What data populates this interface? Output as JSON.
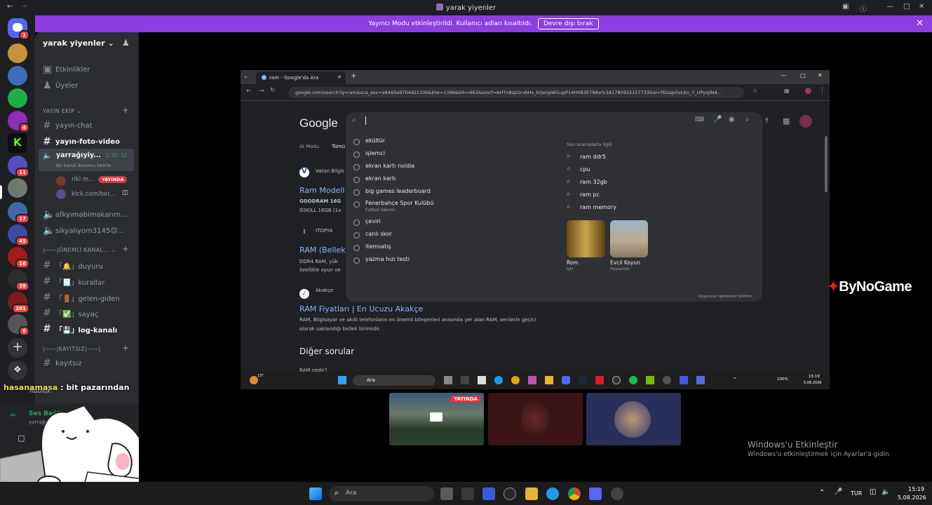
{
  "titlebar": {
    "title": "yarak yiyenler"
  },
  "banner": {
    "text": "Yayıncı Modu etkinleştirildi. Kullanıcı adları kısaltıldı.",
    "button": "Devre dışı bırak"
  },
  "guild_badges": [
    "1",
    "4",
    "11",
    "17",
    "45",
    "16",
    "39",
    "201",
    "6"
  ],
  "server": {
    "name": "yarak yiyenler"
  },
  "sidebar": {
    "top": [
      "Etkinlikler",
      "Üyeler"
    ],
    "cat1": "YAYIN EKİP",
    "ch1": "yayın-chat",
    "ch2": "yayın-foto-video",
    "voice1": "yarrağıyiy...",
    "voice1_time": "1:45:52",
    "voice1_status": "Bir kanal durumu belirle",
    "vm1": "riki m...",
    "vm1_badge": "YAYINDA",
    "vm2": "kick.com/ber...",
    "v2": "afkyımabimakarım...",
    "v3": "sikyalıyom3145😊...",
    "cat2": "|——|ÖNEMLİ KANAL...",
    "c1": "「🔔」duyuru",
    "c2": "「📃」kurallar",
    "c3": "「🚪」gelen-giden",
    "c4": "「✅」sayaç",
    "c5": "「💾」log-kanalı",
    "cat3": "|——|KAYITSIZ|——|",
    "c6": "kayıtsız"
  },
  "user_panel": {
    "activity": "Roblox",
    "voice": "Ses Bağlantısı",
    "server": "yarrağıyiy..."
  },
  "overlay": {
    "user": "hasanamasa",
    "text": " : bit pazarından"
  },
  "share": {
    "tab": "ram - Google'da Ara",
    "url": "google.com/search?q=ram&sca_esv=a8460a9704d2110b&biw=1396&bih=663&sxsrf=AHTn8zpGrvbHs_bQenpWi1upP14H0B3E7NAx%3A1785932157733&ei=fSlzapOvLKn_7_UPyojlNA...",
    "logo": "Google",
    "filters": [
      "AI Modu",
      "Tümü"
    ],
    "suggestions": [
      "ekültür",
      "işlemci",
      "ekran kartı nvidia",
      "ekran kartı",
      "big games leaderboard",
      "Fenerbahçe Spor Kulübü",
      "çeviri",
      "canlı skor",
      "itemsatış",
      "yazma hızı testi"
    ],
    "sugg_sub": "Futbol takımı",
    "related_title": "Son aramalarla ilgili",
    "related": [
      "ram ddr5",
      "cpu",
      "ram 32gb",
      "ram pc",
      "ram memory"
    ],
    "cards": [
      {
        "t": "Rom",
        "s": "İçki"
      },
      {
        "t": "Evcil Koyun",
        "s": "Hayvanlar"
      }
    ],
    "report": "Uygunsuz tahminleri bildirin",
    "r1_site": "Vatan Bilgis",
    "r1_title": "Ram Modell",
    "r1_l1": "GOODRAM 16G",
    "r1_l2": "GSKILL 16GB (1x",
    "r2_site": "ITOPYA",
    "r2_title": "RAM (Bellek",
    "r2_l1": "DDR4 RAM, yük",
    "r2_l2": "özellikle oyun ve",
    "r3_site": "Akakçe",
    "r3_title": "RAM Fiyatları | En Ucuzu Akakçe",
    "r3_l1": "RAM, Bilgisayar ve akıllı telefonların en önemli bileşenleri arasında yer alan RAM, verilerin geçici",
    "r3_l2": "olarak saklandığı bellek birimidir.",
    "others": "Diğer sorular",
    "r4": "RAM nedir?",
    "search_ph": "Ara",
    "temp": "13°",
    "tray_lang": "TUR",
    "battery": "100%",
    "time": "15:19",
    "date": "5.08.2026"
  },
  "tile_badge": "YAYINDA",
  "watermark": "ByNoGame",
  "activation": {
    "title": "Windows'u Etkinleştir",
    "sub": "Windows'u etkinleştirmek için Ayarlar'a gidin."
  },
  "taskbar": {
    "search": "Ara",
    "lang": "TUR",
    "time": "15:19",
    "date": "5.08.2026"
  }
}
